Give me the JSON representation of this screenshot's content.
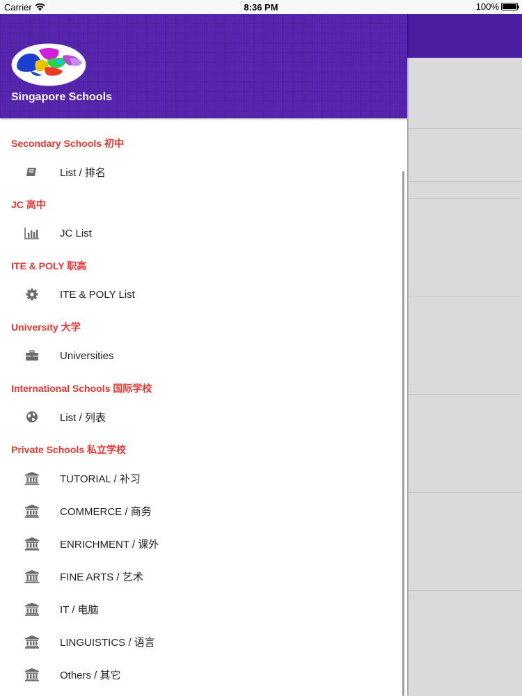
{
  "status_bar": {
    "carrier": "Carrier",
    "time": "8:36 PM",
    "battery": "100%"
  },
  "drawer": {
    "app_title": "Singapore Schools",
    "sections": [
      {
        "title": "Secondary Schools 初中",
        "items": [
          {
            "label": "List / 排名",
            "icon": "book-icon"
          }
        ]
      },
      {
        "title": "JC 高中",
        "items": [
          {
            "label": "JC List",
            "icon": "bar-chart-icon"
          }
        ]
      },
      {
        "title": "ITE & POLY 职高",
        "items": [
          {
            "label": "ITE & POLY List",
            "icon": "gear-icon"
          }
        ]
      },
      {
        "title": "University 大学",
        "items": [
          {
            "label": "Universities",
            "icon": "briefcase-icon"
          }
        ]
      },
      {
        "title": "International Schools 国际学校",
        "items": [
          {
            "label": "List / 列表",
            "icon": "globe-icon"
          }
        ]
      },
      {
        "title": "Private Schools 私立学校",
        "items": [
          {
            "label": "TUTORIAL / 补习",
            "icon": "institution-icon"
          },
          {
            "label": "COMMERCE / 商务",
            "icon": "institution-icon"
          },
          {
            "label": "ENRICHMENT / 课外",
            "icon": "institution-icon"
          },
          {
            "label": "FINE ARTS / 艺术",
            "icon": "institution-icon"
          },
          {
            "label": "IT / 电脑",
            "icon": "institution-icon"
          },
          {
            "label": "LINGUISTICS / 语言",
            "icon": "institution-icon"
          },
          {
            "label": "Others / 其它",
            "icon": "institution-icon"
          }
        ]
      }
    ]
  },
  "colors": {
    "header": "#5525ad",
    "section_title": "#e53935",
    "icon": "#6b6b6b"
  }
}
